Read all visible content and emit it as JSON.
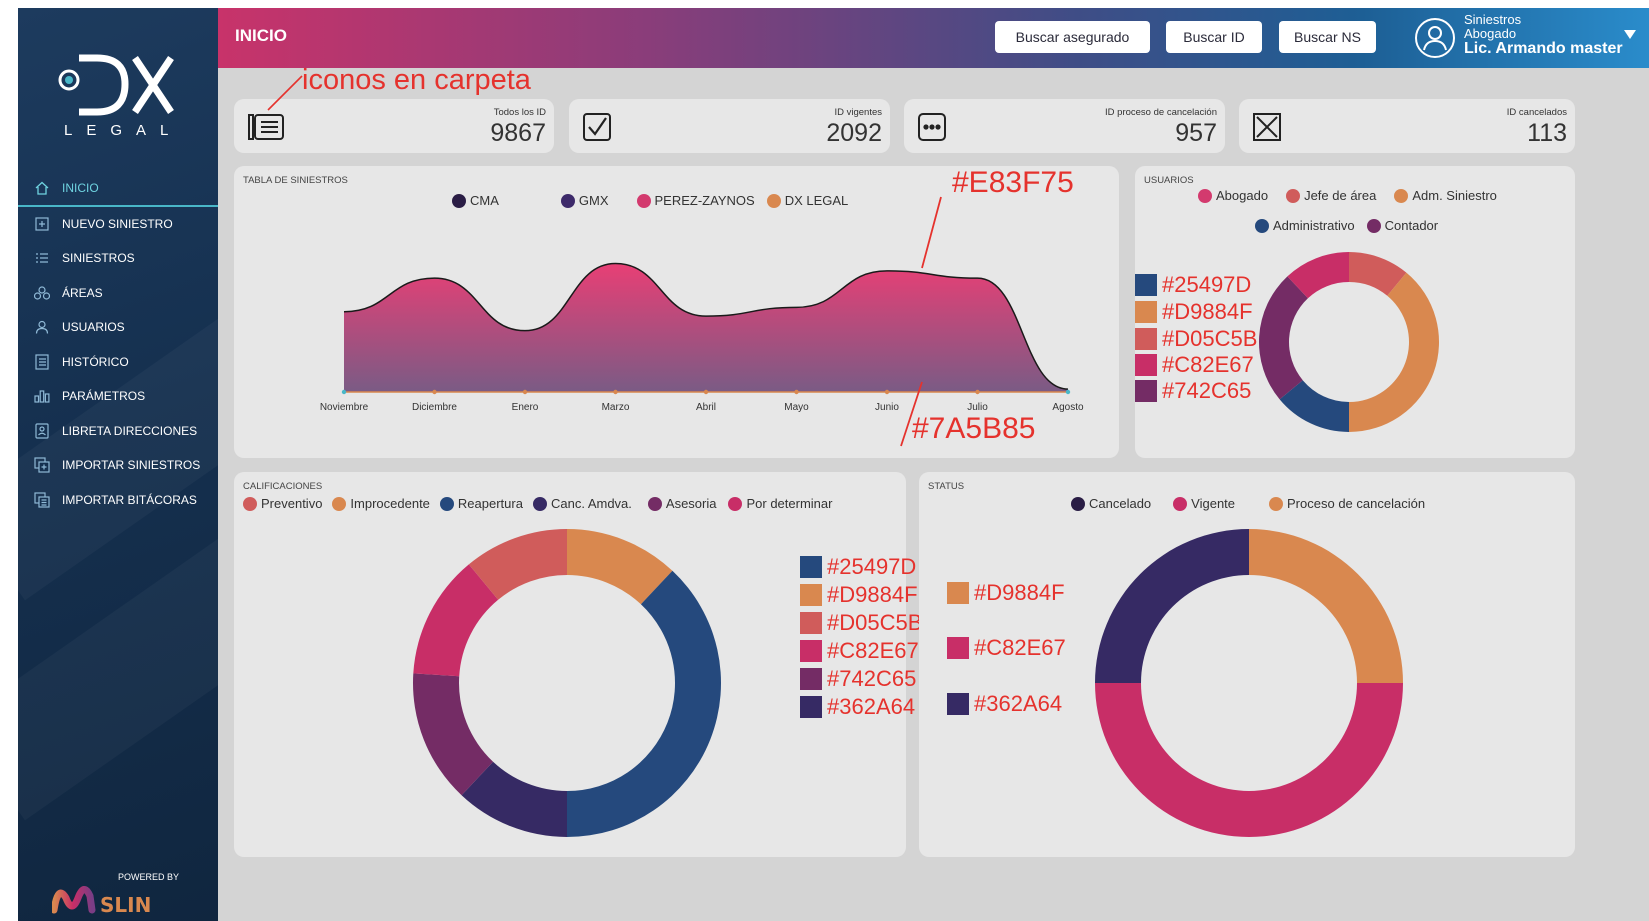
{
  "sidebar": {
    "logo_text": "DX",
    "logo_subtext": "LEGAL",
    "items": [
      {
        "label": "INICIO",
        "icon": "home-icon"
      },
      {
        "label": "NUEVO SINIESTRO",
        "icon": "plus-square-icon"
      },
      {
        "label": "SINIESTROS",
        "icon": "list-icon"
      },
      {
        "label": "ÁREAS",
        "icon": "areas-icon"
      },
      {
        "label": "USUARIOS",
        "icon": "user-icon"
      },
      {
        "label": "HISTÓRICO",
        "icon": "history-icon"
      },
      {
        "label": "PARÁMETROS",
        "icon": "bar-chart-icon"
      },
      {
        "label": "LIBRETA DIRECCIONES",
        "icon": "address-book-icon"
      },
      {
        "label": "IMPORTAR SINIESTROS",
        "icon": "import-icon"
      },
      {
        "label": "IMPORTAR BITÁCORAS",
        "icon": "import-log-icon"
      }
    ],
    "powered_by": "POWERED BY",
    "powered_brand": "SLIN"
  },
  "header": {
    "title": "INICIO",
    "buttons": [
      "Buscar asegurado",
      "Buscar ID",
      "Buscar NS"
    ],
    "user": {
      "line1": "Siniestros",
      "line2": "Abogado",
      "name": "Lic. Armando master"
    }
  },
  "stats": [
    {
      "label": "Todos los ID",
      "value": "9867",
      "icon": "folder-list-icon"
    },
    {
      "label": "ID vigentes",
      "value": "2092",
      "icon": "checkbox-icon"
    },
    {
      "label": "ID proceso de cancelación",
      "value": "957",
      "icon": "dots-icon"
    },
    {
      "label": "ID cancelados",
      "value": "113",
      "icon": "x-box-icon"
    }
  ],
  "annotations": {
    "icons_note": "iconos en carpeta",
    "area_top": "#E83F75",
    "area_bottom": "#7A5B85"
  },
  "chart_data": [
    {
      "type": "area",
      "title": "TABLA DE SINIESTROS",
      "legend": [
        {
          "name": "CMA",
          "color": "#2a1d45"
        },
        {
          "name": "GMX",
          "color": "#3d2a6a"
        },
        {
          "name": "PEREZ-ZAYNOS",
          "color": "#d33a6e"
        },
        {
          "name": "DX LEGAL",
          "color": "#d9884f"
        }
      ],
      "x": [
        "Noviembre",
        "Diciembre",
        "Enero",
        "Marzo",
        "Abril",
        "Mayo",
        "Junio",
        "Julio",
        "Agosto"
      ],
      "values": [
        0.55,
        0.78,
        0.42,
        0.88,
        0.52,
        0.58,
        0.83,
        0.78,
        0.02
      ],
      "fill_top": "#E83F75",
      "fill_bottom": "#7A5B85"
    },
    {
      "type": "pie",
      "title": "USUARIOS",
      "legend": [
        {
          "name": "Abogado",
          "color": "#d33a6e"
        },
        {
          "name": "Jefe de área",
          "color": "#d05c5b"
        },
        {
          "name": "Adm. Siniestro",
          "color": "#d9884f"
        },
        {
          "name": "Administrativo",
          "color": "#25497d"
        },
        {
          "name": "Contador",
          "color": "#742c65"
        }
      ],
      "swatches": [
        "#25497D",
        "#D9884F",
        "#D05C5B",
        "#C82E67",
        "#742C65"
      ],
      "slices": [
        {
          "color": "#D05C5B",
          "value": 0.11
        },
        {
          "color": "#D9884F",
          "value": 0.39
        },
        {
          "color": "#25497D",
          "value": 0.14
        },
        {
          "color": "#742C65",
          "value": 0.24
        },
        {
          "color": "#C82E67",
          "value": 0.12
        }
      ]
    },
    {
      "type": "pie",
      "title": "CALIFICACIONES",
      "legend": [
        {
          "name": "Preventivo",
          "color": "#d05c5b"
        },
        {
          "name": "Improcedente",
          "color": "#d9884f"
        },
        {
          "name": "Reapertura",
          "color": "#25497d"
        },
        {
          "name": "Canc. Amdva.",
          "color": "#362a64"
        },
        {
          "name": "Asesoria",
          "color": "#742c65"
        },
        {
          "name": "Por determinar",
          "color": "#c82e67"
        }
      ],
      "swatches": [
        "#25497D",
        "#D9884F",
        "#D05C5B",
        "#C82E67",
        "#742C65",
        "#362A64"
      ],
      "slices": [
        {
          "color": "#D9884F",
          "value": 0.12
        },
        {
          "color": "#25497D",
          "value": 0.38
        },
        {
          "color": "#362A64",
          "value": 0.12
        },
        {
          "color": "#742C65",
          "value": 0.14
        },
        {
          "color": "#C82E67",
          "value": 0.13
        },
        {
          "color": "#D05C5B",
          "value": 0.11
        }
      ]
    },
    {
      "type": "pie",
      "title": "STATUS",
      "legend": [
        {
          "name": "Cancelado",
          "color": "#2a1d45"
        },
        {
          "name": "Vigente",
          "color": "#c82e67"
        },
        {
          "name": "Proceso de cancelación",
          "color": "#d9884f"
        }
      ],
      "swatches": [
        "#D9884F",
        "#C82E67",
        "#362A64"
      ],
      "slices": [
        {
          "color": "#D9884F",
          "value": 0.25
        },
        {
          "color": "#C82E67",
          "value": 0.5
        },
        {
          "color": "#362A64",
          "value": 0.25
        }
      ]
    }
  ]
}
